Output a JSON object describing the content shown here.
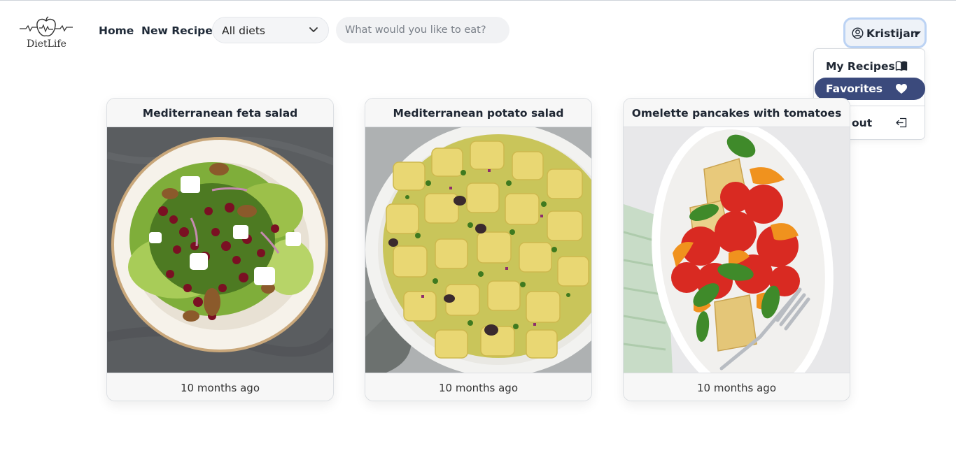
{
  "brand": {
    "name": "DietLife",
    "icon": "apple-heartbeat-logo"
  },
  "nav": {
    "home_label": "Home",
    "new_recipe_label": "New Recipe"
  },
  "diet_filter": {
    "selected": "All diets",
    "icon": "chevron-down-icon"
  },
  "search": {
    "placeholder": "What would you like to eat?",
    "value": ""
  },
  "user_menu": {
    "username": "Kristijan",
    "icon": "user-circle-icon",
    "items": [
      {
        "label": "My Recipes",
        "icon": "book-icon",
        "active": false
      },
      {
        "label": "Favorites",
        "icon": "heart-icon",
        "active": true
      },
      {
        "label": "Log out",
        "icon": "logout-icon",
        "active": false
      }
    ]
  },
  "recipes": [
    {
      "title": "Mediterranean feta salad",
      "time": "10 months ago",
      "image": "feta-salad-photo"
    },
    {
      "title": "Mediterranean potato salad",
      "time": "10 months ago",
      "image": "potato-salad-photo"
    },
    {
      "title": "Omelette pancakes with tomatoes",
      "time": "10 months ago",
      "image": "omelette-pancakes-photo"
    }
  ],
  "colors": {
    "accent": "#3b4a7c",
    "card_header": "#f7f7f7",
    "user_button_border": "#bcd3f4"
  }
}
